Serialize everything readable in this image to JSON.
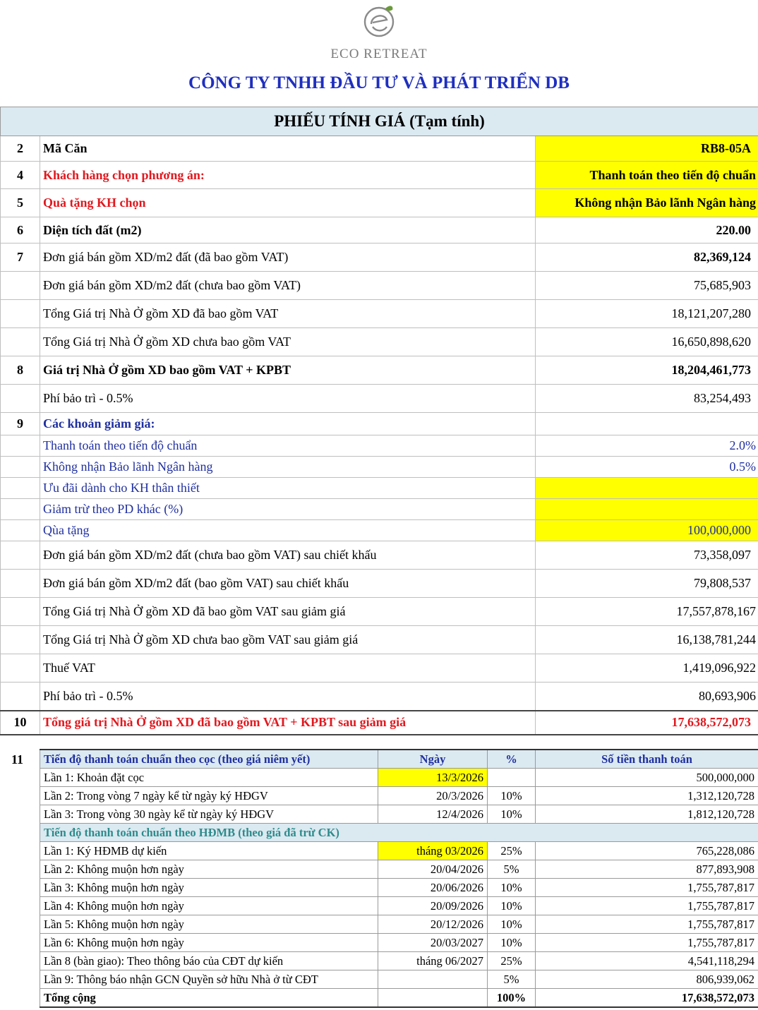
{
  "brand": {
    "logo_text": "ECO RETREAT",
    "logo_letter": "e"
  },
  "company": "CÔNG TY TNHH ĐẦU TƯ VÀ PHÁT TRIỂN DB",
  "title": "PHIẾU TÍNH GIÁ (Tạm tính)",
  "rows": [
    {
      "no": "2",
      "label": "Mã Căn",
      "value": "RB8-05A"
    },
    {
      "no": "4",
      "label": "Khách hàng chọn phương án:",
      "value": "Thanh toán theo tiến độ chuẩn"
    },
    {
      "no": "5",
      "label": "Quà tặng KH chọn",
      "value": "Không nhận Bảo lãnh Ngân hàng"
    },
    {
      "no": "6",
      "label": "Diện tích đất (m2)",
      "value": "220.00"
    },
    {
      "no": "7",
      "label": "Đơn giá bán gồm XD/m2 đất (đã bao gồm VAT)",
      "value": "82,369,124"
    },
    {
      "no": "",
      "label": "Đơn giá bán gồm XD/m2 đất (chưa bao gồm VAT)",
      "value": "75,685,903"
    },
    {
      "no": "",
      "label": "Tổng Giá trị Nhà Ở gồm XD đã bao gồm VAT",
      "value": "18,121,207,280"
    },
    {
      "no": "",
      "label": "Tổng Giá trị Nhà Ở gồm XD chưa bao gồm VAT",
      "value": "16,650,898,620"
    },
    {
      "no": "8",
      "label": "Giá trị Nhà Ở gồm XD bao gồm VAT + KPBT",
      "value": "18,204,461,773"
    },
    {
      "no": "",
      "label": "Phí bảo trì - 0.5%",
      "value": "83,254,493"
    },
    {
      "no": "9",
      "label": "Các khoản giảm giá:",
      "value": ""
    },
    {
      "no": "",
      "label": "Thanh toán theo tiến độ chuẩn",
      "value": "2.0%"
    },
    {
      "no": "",
      "label": "Không nhận Bảo lãnh Ngân hàng",
      "value": "0.5%"
    },
    {
      "no": "",
      "label": "Ưu đãi dành cho KH thân thiết",
      "value": ""
    },
    {
      "no": "",
      "label": "Giảm trừ theo PD khác (%)",
      "value": ""
    },
    {
      "no": "",
      "label": "Qùa tặng",
      "value": "100,000,000"
    },
    {
      "no": "",
      "label": "Đơn giá bán gồm XD/m2 đất (chưa bao gồm VAT) sau chiết khấu",
      "value": "73,358,097"
    },
    {
      "no": "",
      "label": "Đơn giá bán gồm XD/m2 đất (bao gồm VAT) sau chiết khấu",
      "value": "79,808,537"
    },
    {
      "no": "",
      "label": "Tổng Giá trị Nhà Ở gồm XD đã bao gồm VAT sau giảm giá",
      "value": "17,557,878,167"
    },
    {
      "no": "",
      "label": "Tổng Giá trị Nhà Ở gồm XD chưa bao gồm VAT sau giảm giá",
      "value": "16,138,781,244"
    },
    {
      "no": "",
      "label": "Thuế VAT",
      "value": "1,419,096,922"
    },
    {
      "no": "",
      "label": "Phí bảo trì - 0.5%",
      "value": "80,693,906"
    },
    {
      "no": "10",
      "label": "Tổng giá trị Nhà Ở gồm XD đã bao gồm VAT + KPBT sau giảm giá",
      "value": "17,638,572,073"
    }
  ],
  "schedule": {
    "no": "11",
    "header": {
      "label": "Tiến độ thanh toán chuẩn theo cọc (theo giá niêm yết)",
      "date": "Ngày",
      "pct": "%",
      "amount": "Số tiền thanh toán"
    },
    "deposit_rows": [
      {
        "label": "Lần 1: Khoản đặt cọc",
        "date": "13/3/2026",
        "pct": "",
        "amount": "500,000,000"
      },
      {
        "label": "Lần 2: Trong vòng 7 ngày kể từ ngày ký HĐGV",
        "date": "20/3/2026",
        "pct": "10%",
        "amount": "1,312,120,728"
      },
      {
        "label": "Lần 3: Trong vòng 30 ngày kể từ ngày ký HĐGV",
        "date": "12/4/2026",
        "pct": "10%",
        "amount": "1,812,120,728"
      }
    ],
    "subheader": "Tiến độ thanh toán chuẩn theo HĐMB (theo giá đã trừ CK)",
    "contract_rows": [
      {
        "label": "Lần 1: Ký HĐMB dự kiến",
        "date": "tháng 03/2026",
        "pct": "25%",
        "amount": "765,228,086"
      },
      {
        "label": "Lần 2: Không muộn hơn ngày",
        "date": "20/04/2026",
        "pct": "5%",
        "amount": "877,893,908"
      },
      {
        "label": "Lần 3: Không muộn hơn ngày",
        "date": "20/06/2026",
        "pct": "10%",
        "amount": "1,755,787,817"
      },
      {
        "label": "Lần 4: Không muộn hơn ngày",
        "date": "20/09/2026",
        "pct": "10%",
        "amount": "1,755,787,817"
      },
      {
        "label": "Lần 5: Không muộn hơn ngày",
        "date": "20/12/2026",
        "pct": "10%",
        "amount": "1,755,787,817"
      },
      {
        "label": "Lần 6: Không muộn hơn ngày",
        "date": "20/03/2027",
        "pct": "10%",
        "amount": "1,755,787,817"
      },
      {
        "label": "Lần 8 (bàn giao): Theo thông báo của CĐT dự kiến",
        "date": "tháng 06/2027",
        "pct": "25%",
        "amount": "4,541,118,294"
      },
      {
        "label": "Lần 9: Thông báo nhận GCN Quyền sở hữu Nhà ở từ CĐT",
        "date": "",
        "pct": "5%",
        "amount": "806,939,062"
      }
    ],
    "total": {
      "label": "Tổng cộng",
      "pct": "100%",
      "amount": "17,638,572,073"
    }
  },
  "colors": {
    "accent_blue": "#1f2fbf",
    "red": "#e0191f",
    "highlight": "#ffff00",
    "header_bg": "#dbe9f1",
    "teal": "#2e8b8b"
  }
}
